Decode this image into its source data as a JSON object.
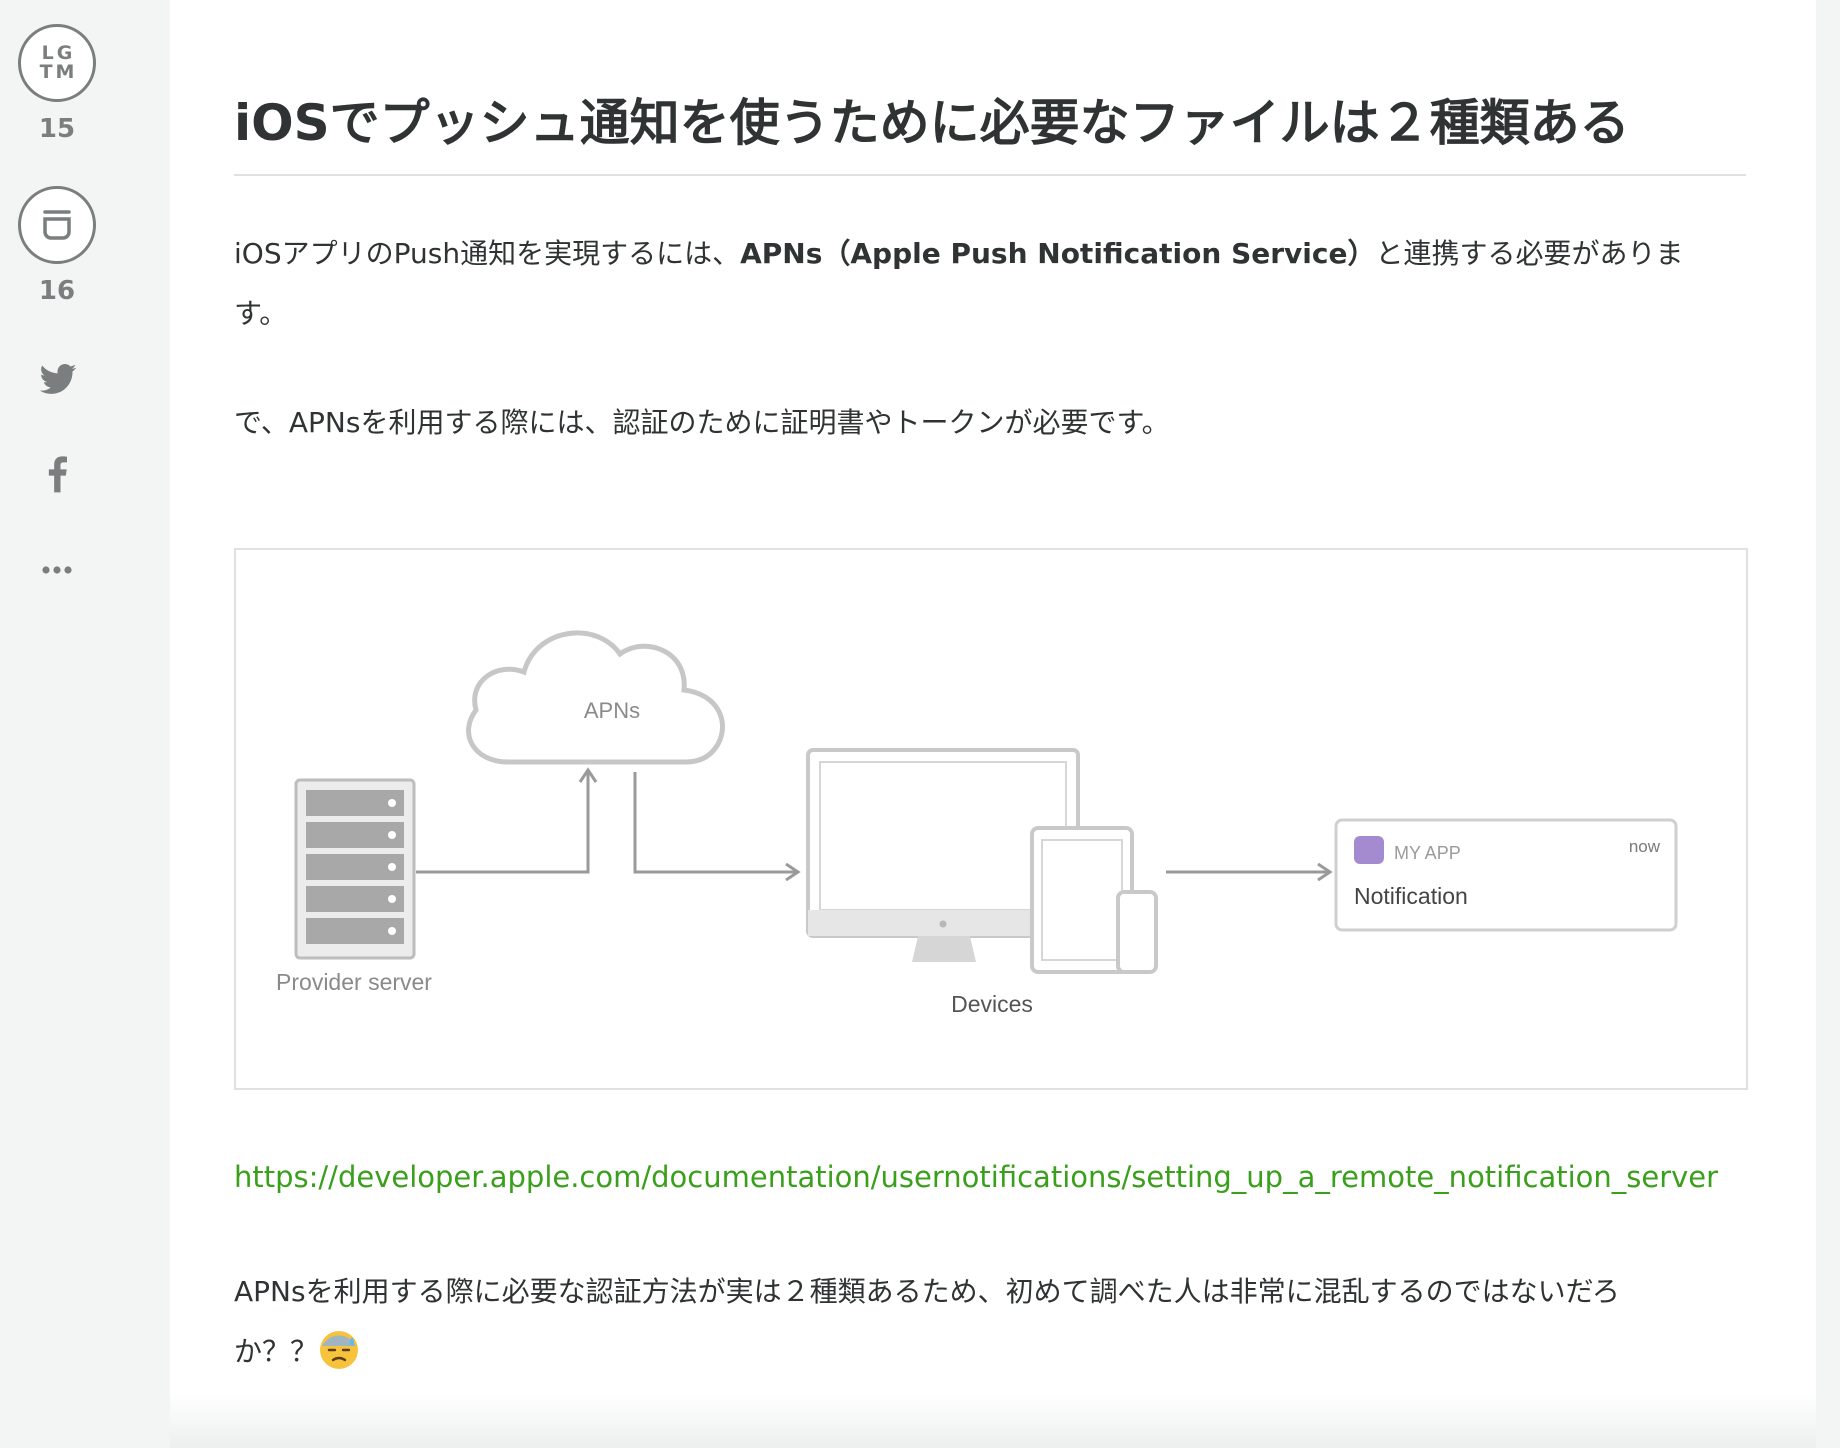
{
  "sidebar": {
    "lgtm": {
      "label_line1": "LG",
      "label_line2": "TM",
      "count": "15"
    },
    "stock": {
      "count": "16"
    },
    "share": [
      "twitter-icon",
      "facebook-icon",
      "more-icon"
    ]
  },
  "article": {
    "title": "iOSでプッシュ通知を使うために必要なファイルは２種類ある",
    "p1_before": "iOSアプリのPush通知を実現するには、",
    "p1_bold": "APNs（Apple Push Notification Service）",
    "p1_after": "と連携する必要がありま",
    "p1_line2": "す。",
    "p2": "で、APNsを利用する際には、認証のために証明書やトークンが必要です。",
    "figure": {
      "cloud_label": "APNs",
      "server_label": "Provider server",
      "devices_label": "Devices",
      "app_name": "MY APP",
      "time": "now",
      "notification": "Notification"
    },
    "link": "https://developer.apple.com/documentation/usernotifications/setting_up_a_remote_notification_server",
    "p3_line1": "APNsを利用する際に必要な認証方法が実は２種類あるため、初めて調べた人は非常に混乱するのではないだろ",
    "p3_line2": "か？？"
  },
  "colors": {
    "link": "#3aa01c",
    "icon_gray": "#7a7e7e",
    "app_icon": "#a48bd0"
  }
}
